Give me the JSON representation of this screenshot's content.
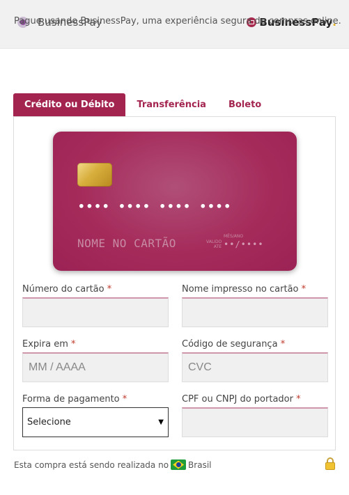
{
  "header": {
    "option_label": "BusinessPay",
    "brand_name": "BusinessPay",
    "brand_dot": "."
  },
  "intro": "Pague usando BusinessPay, uma experiência segura de compras online.",
  "tabs": [
    {
      "label": "Crédito ou Débito",
      "active": true
    },
    {
      "label": "Transferência",
      "active": false
    },
    {
      "label": "Boleto",
      "active": false
    }
  ],
  "card": {
    "number": "•••• •••• •••• ••••",
    "name": "NOME NO CARTÃO",
    "valid_label": "VALIDO ATE",
    "month_year_label": "MÊS/ANO",
    "expiry": "••/••••"
  },
  "form": {
    "card_number": {
      "label": "Número do cartão",
      "required": "*",
      "value": "",
      "placeholder": ""
    },
    "card_name": {
      "label": "Nome impresso no cartão",
      "required": "*",
      "value": "",
      "placeholder": ""
    },
    "expiry": {
      "label": "Expira em",
      "required": "*",
      "value": "",
      "placeholder": "MM / AAAA"
    },
    "cvc": {
      "label": "Código de segurança",
      "required": "*",
      "value": "",
      "placeholder": "CVC"
    },
    "payment_method": {
      "label": "Forma de pagamento",
      "required": "*",
      "selected": "Selecione"
    },
    "document": {
      "label": "CPF ou CNPJ do portador",
      "required": "*",
      "value": "",
      "placeholder": ""
    }
  },
  "footer": {
    "text": "Esta compra está sendo realizada no",
    "country": "Brasil"
  },
  "colors": {
    "accent": "#a3254f",
    "card": "#a52b5b",
    "chip": "#d7ae3c"
  }
}
